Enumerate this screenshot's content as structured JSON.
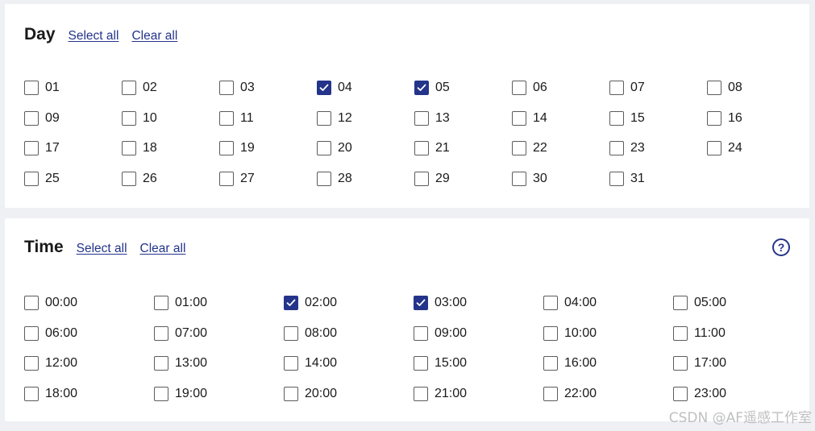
{
  "day": {
    "title": "Day",
    "select_all": "Select all",
    "clear_all": "Clear all",
    "options": [
      {
        "label": "01",
        "checked": false
      },
      {
        "label": "02",
        "checked": false
      },
      {
        "label": "03",
        "checked": false
      },
      {
        "label": "04",
        "checked": true
      },
      {
        "label": "05",
        "checked": true
      },
      {
        "label": "06",
        "checked": false
      },
      {
        "label": "07",
        "checked": false
      },
      {
        "label": "08",
        "checked": false
      },
      {
        "label": "09",
        "checked": false
      },
      {
        "label": "10",
        "checked": false
      },
      {
        "label": "11",
        "checked": false
      },
      {
        "label": "12",
        "checked": false
      },
      {
        "label": "13",
        "checked": false
      },
      {
        "label": "14",
        "checked": false
      },
      {
        "label": "15",
        "checked": false
      },
      {
        "label": "16",
        "checked": false
      },
      {
        "label": "17",
        "checked": false
      },
      {
        "label": "18",
        "checked": false
      },
      {
        "label": "19",
        "checked": false
      },
      {
        "label": "20",
        "checked": false
      },
      {
        "label": "21",
        "checked": false
      },
      {
        "label": "22",
        "checked": false
      },
      {
        "label": "23",
        "checked": false
      },
      {
        "label": "24",
        "checked": false
      },
      {
        "label": "25",
        "checked": false
      },
      {
        "label": "26",
        "checked": false
      },
      {
        "label": "27",
        "checked": false
      },
      {
        "label": "28",
        "checked": false
      },
      {
        "label": "29",
        "checked": false
      },
      {
        "label": "30",
        "checked": false
      },
      {
        "label": "31",
        "checked": false
      }
    ]
  },
  "time": {
    "title": "Time",
    "select_all": "Select all",
    "clear_all": "Clear all",
    "help_icon": "question-circle-icon",
    "options": [
      {
        "label": "00:00",
        "checked": false
      },
      {
        "label": "01:00",
        "checked": false
      },
      {
        "label": "02:00",
        "checked": true
      },
      {
        "label": "03:00",
        "checked": true
      },
      {
        "label": "04:00",
        "checked": false
      },
      {
        "label": "05:00",
        "checked": false
      },
      {
        "label": "06:00",
        "checked": false
      },
      {
        "label": "07:00",
        "checked": false
      },
      {
        "label": "08:00",
        "checked": false
      },
      {
        "label": "09:00",
        "checked": false
      },
      {
        "label": "10:00",
        "checked": false
      },
      {
        "label": "11:00",
        "checked": false
      },
      {
        "label": "12:00",
        "checked": false
      },
      {
        "label": "13:00",
        "checked": false
      },
      {
        "label": "14:00",
        "checked": false
      },
      {
        "label": "15:00",
        "checked": false
      },
      {
        "label": "16:00",
        "checked": false
      },
      {
        "label": "17:00",
        "checked": false
      },
      {
        "label": "18:00",
        "checked": false
      },
      {
        "label": "19:00",
        "checked": false
      },
      {
        "label": "20:00",
        "checked": false
      },
      {
        "label": "21:00",
        "checked": false
      },
      {
        "label": "22:00",
        "checked": false
      },
      {
        "label": "23:00",
        "checked": false
      }
    ]
  },
  "watermark": "CSDN @AF遥感工作室",
  "colors": {
    "accent": "#24348a",
    "background": "#eff0f4",
    "panel": "#ffffff"
  }
}
